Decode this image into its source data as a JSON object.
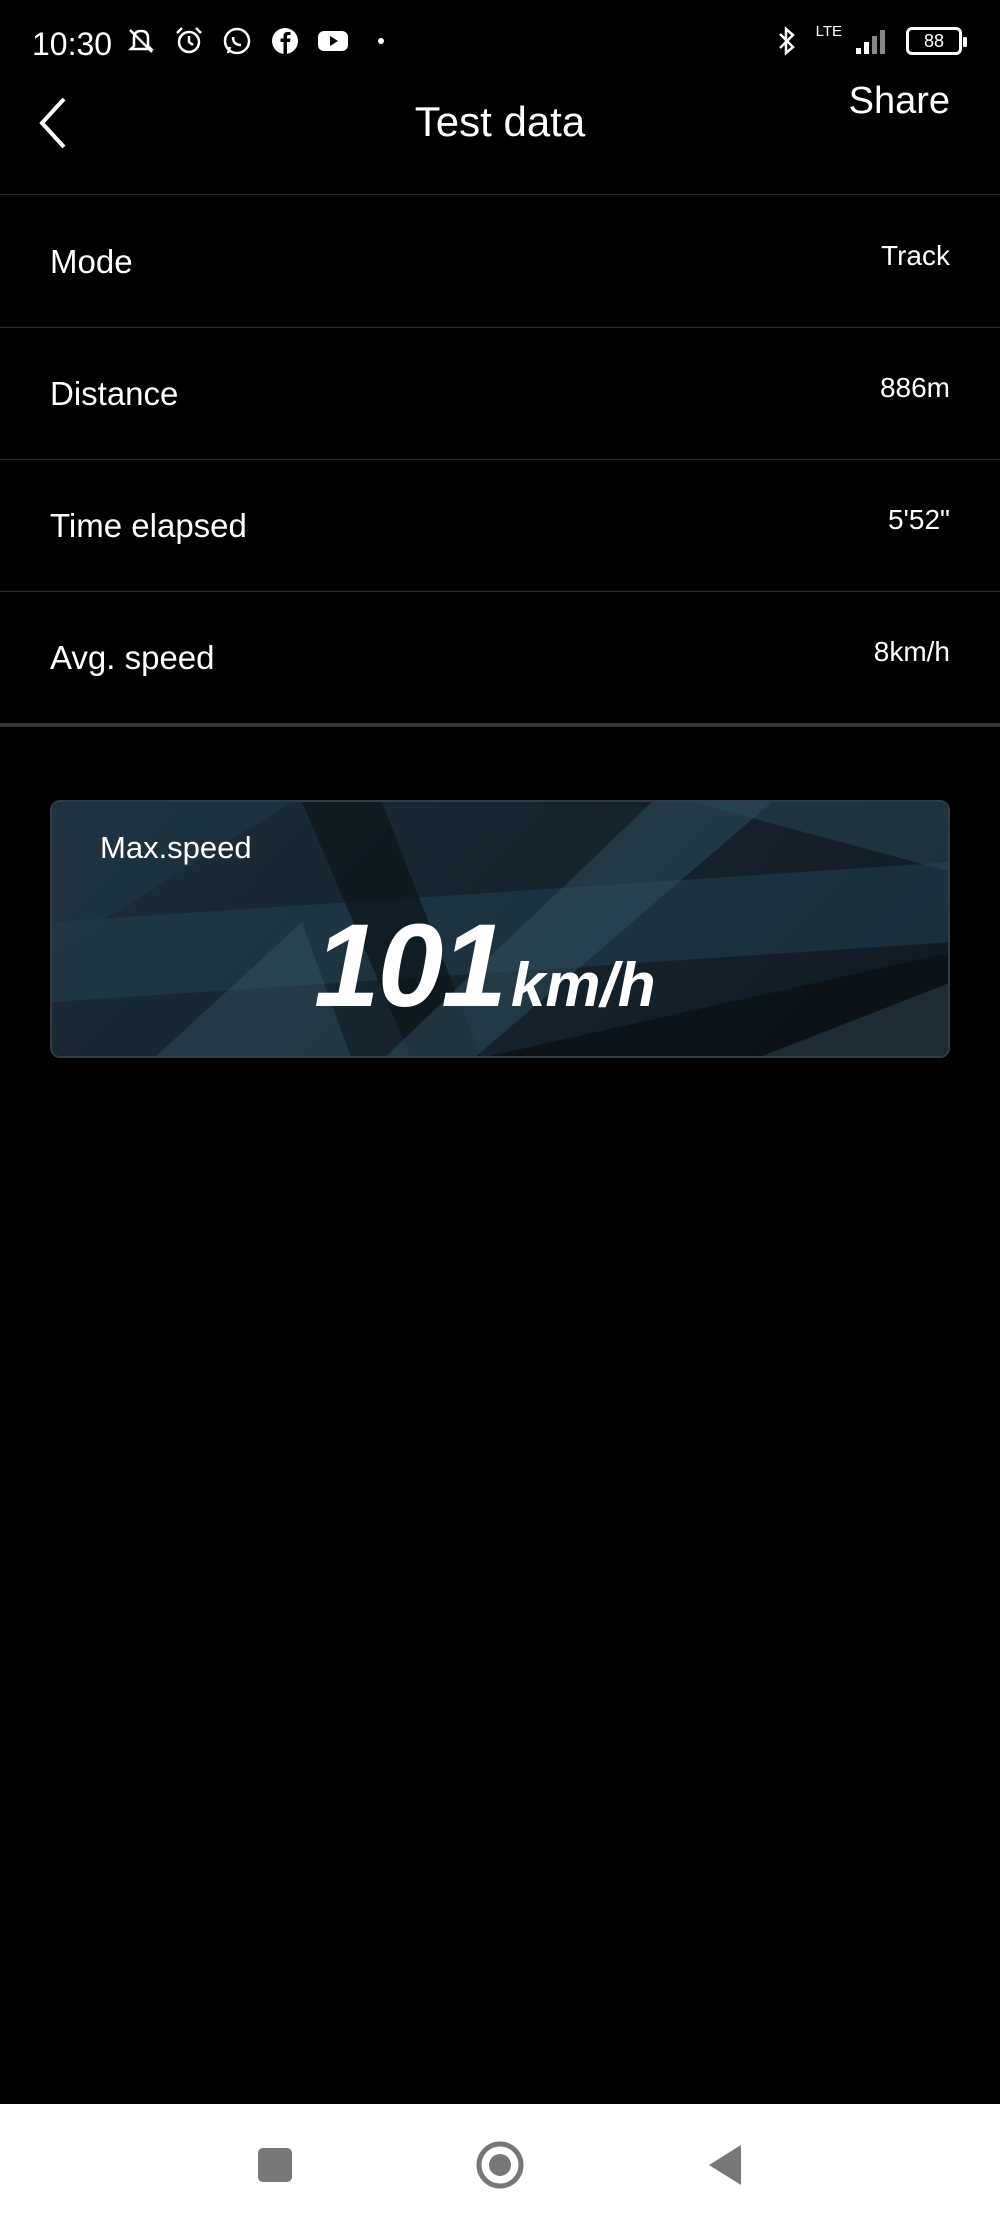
{
  "status_bar": {
    "time": "10:30",
    "network": "LTE",
    "battery": "88",
    "icons": [
      "mute-icon",
      "alarm-icon",
      "whatsapp-icon",
      "facebook-icon",
      "youtube-icon",
      "dot-icon",
      "bluetooth-icon",
      "signal-icon",
      "battery-icon"
    ]
  },
  "header": {
    "title": "Test data",
    "share_label": "Share",
    "back_icon": "chevron-left-icon"
  },
  "rows": [
    {
      "label": "Mode",
      "value": "Track"
    },
    {
      "label": "Distance",
      "value": "886m"
    },
    {
      "label": "Time elapsed",
      "value": "5'52\""
    },
    {
      "label": "Avg. speed",
      "value": "8km/h"
    }
  ],
  "max_speed": {
    "label": "Max.speed",
    "value": "101",
    "unit": "km/h"
  },
  "nav_bar": {
    "icons": [
      "recents-square-icon",
      "home-circle-icon",
      "back-triangle-icon"
    ]
  },
  "colors": {
    "background": "#000000",
    "text": "#ffffff",
    "divider": "#2a2a2a",
    "card": "#1d2f3b"
  }
}
